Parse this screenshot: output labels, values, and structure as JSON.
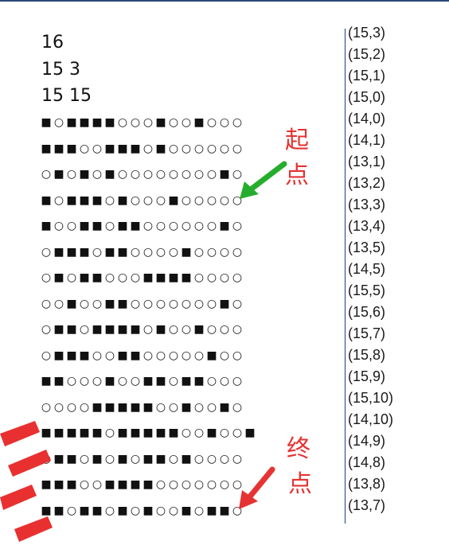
{
  "header": [
    "16",
    "15 3",
    "15 15"
  ],
  "maze_rows": [
    "■○■■■■○○○■○○■○○○",
    "■■■○○■■■○■○○○○○○",
    "○■○■○■○○○○○○○○■○",
    "■○■■■○■○○○■○○○○○",
    "■○○■■○■■○○○○○○■○",
    "○■■■○■■○○○○■○○○○",
    "○■○■■○○○■■■■○○○○",
    "○○■○○■■○○○○○○○■○",
    "○■■○■■■■○■○○■○○○",
    "○■■■○○■■○○○○○■○○",
    "■■○○○■○○■■○■■○○○",
    "○○○○■■■■■○○■○○■○",
    "■■■■■○■■■■■○○■○○■",
    "○■■○■○■○■■○■○○○○",
    "■■■○○■■■■○○○○○○○",
    "■■○■■○■○■○○■○■■○"
  ],
  "coords": [
    "(15,3)",
    "(15,2)",
    "(15,1)",
    "(15,0)",
    "(14,0)",
    "(14,1)",
    "(13,1)",
    "(13,2)",
    "(13,3)",
    "(13,4)",
    "(13,5)",
    "(14,5)",
    "(15,5)",
    "(15,6)",
    "(15,7)",
    "(15,8)",
    "(15,9)",
    "(15,10)",
    "(14,10)",
    "(14,9)",
    "(14,8)",
    "(13,8)",
    "(13,7)"
  ],
  "annotations": {
    "start": [
      "起",
      "点"
    ],
    "end": [
      "终",
      "点"
    ]
  },
  "colors": {
    "annotation_red": "#e53333",
    "start_arrow_green": "#27ad2e",
    "end_arrow_red": "#e53333",
    "divider_blue": "#1b3d80"
  }
}
